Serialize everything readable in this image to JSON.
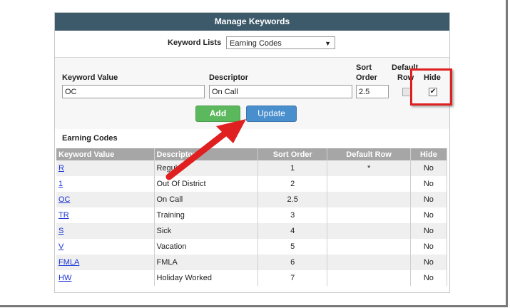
{
  "header": {
    "title": "Manage Keywords"
  },
  "keyword_lists": {
    "label": "Keyword Lists",
    "selected": "Earning Codes"
  },
  "form": {
    "keyword_value_label": "Keyword Value",
    "descriptor_label": "Descriptor",
    "sort_order_label_1": "Sort",
    "sort_order_label_2": "Order",
    "default_row_label_1": "Default",
    "default_row_label_2": "Row",
    "hide_label": "Hide",
    "keyword_value": "OC",
    "descriptor": "On Call",
    "sort_order": "2.5",
    "default_row_checked": false,
    "hide_checked": true,
    "add_label": "Add",
    "update_label": "Update"
  },
  "section": {
    "title": "Earning Codes"
  },
  "table": {
    "columns": [
      "Keyword Value",
      "Descriptor",
      "Sort Order",
      "Default Row",
      "Hide"
    ],
    "rows": [
      {
        "keyword": "R",
        "descriptor": "Regular",
        "sort": "1",
        "default": "*",
        "hide": "No"
      },
      {
        "keyword": "1",
        "descriptor": "Out Of District",
        "sort": "2",
        "default": "",
        "hide": "No"
      },
      {
        "keyword": "OC",
        "descriptor": "On Call",
        "sort": "2.5",
        "default": "",
        "hide": "No"
      },
      {
        "keyword": "TR",
        "descriptor": "Training",
        "sort": "3",
        "default": "",
        "hide": "No"
      },
      {
        "keyword": "S",
        "descriptor": "Sick",
        "sort": "4",
        "default": "",
        "hide": "No"
      },
      {
        "keyword": "V",
        "descriptor": "Vacation",
        "sort": "5",
        "default": "",
        "hide": "No"
      },
      {
        "keyword": "FMLA",
        "descriptor": "FMLA",
        "sort": "6",
        "default": "",
        "hide": "No"
      },
      {
        "keyword": "HW",
        "descriptor": "Holiday Worked",
        "sort": "7",
        "default": "",
        "hide": "No"
      }
    ]
  },
  "colors": {
    "header_bg": "#3d5a6b",
    "add_button": "#5cb85c",
    "update_button": "#4a8fcd",
    "annotation": "#e02020"
  }
}
